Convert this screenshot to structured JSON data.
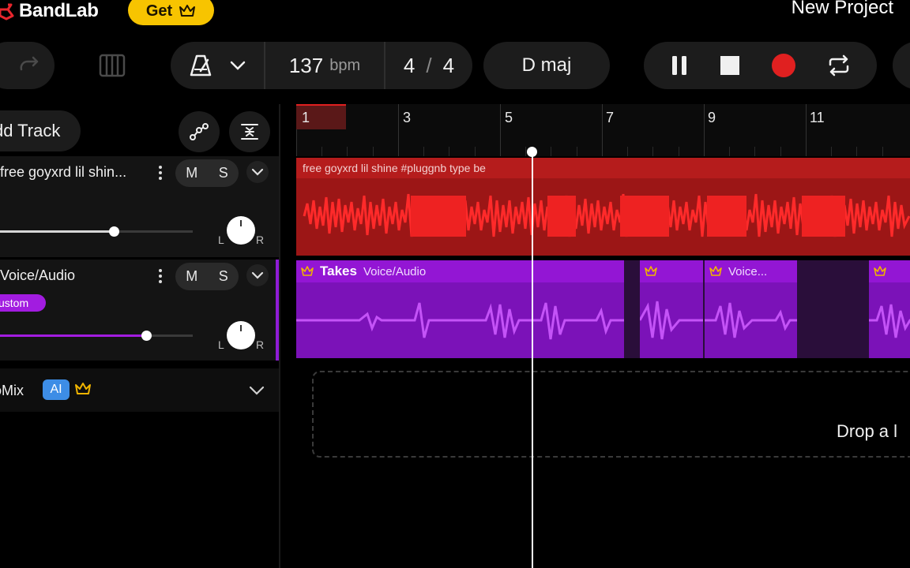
{
  "brand": {
    "name": "BandLab",
    "get_label": "Get"
  },
  "project": {
    "title": "New Project"
  },
  "toolbar": {
    "tempo": "137",
    "tempo_unit": "bpm",
    "time_sig_num": "4",
    "time_sig_sep": "/",
    "time_sig_den": "4",
    "key": "D maj",
    "record_color": "#e02020"
  },
  "tracks_panel": {
    "add_track_label": "dd Track",
    "tracks": [
      {
        "name": "free goyxrd  lil shin...",
        "mute": "M",
        "solo": "S",
        "pan_l": "L",
        "pan_r": "R",
        "volume": 0.59,
        "color": "#e02020"
      },
      {
        "name": "Voice/Audio",
        "mute": "M",
        "solo": "S",
        "preset": "ustom",
        "pan_l": "L",
        "pan_r": "R",
        "volume": 0.76,
        "color": "#8f1cd6"
      }
    ],
    "automix": {
      "label": "oMix",
      "badge": "AI"
    }
  },
  "timeline": {
    "ruler": [
      "1",
      "3",
      "5",
      "7",
      "9",
      "11"
    ],
    "lane1_title": "free goyxrd  lil shine  #pluggnb type be",
    "clips": [
      {
        "takes": "Takes",
        "name": "Voice/Audio"
      },
      {
        "takes": "",
        "name": ""
      },
      {
        "takes": "",
        "name": "Voice..."
      },
      {
        "takes": "",
        "name": ""
      }
    ],
    "drop_text": "Drop a l"
  }
}
